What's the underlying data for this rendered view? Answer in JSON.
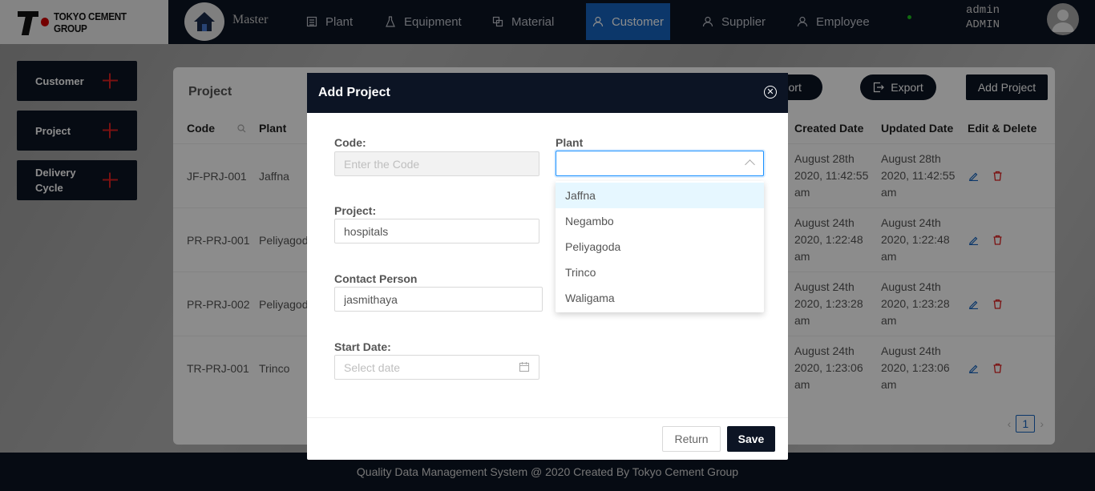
{
  "brand": {
    "name": "TOKYO CEMENT GROUP"
  },
  "nav": {
    "master": "Master",
    "items": [
      {
        "label": "Plant"
      },
      {
        "label": "Equipment"
      },
      {
        "label": "Material"
      },
      {
        "label": "Customer"
      },
      {
        "label": "Supplier"
      },
      {
        "label": "Employee"
      }
    ],
    "active": "Customer",
    "user": {
      "name": "admin",
      "role": "ADMIN"
    }
  },
  "sidebar": [
    {
      "label": "Customer"
    },
    {
      "label": "Project"
    },
    {
      "label": "Delivery Cycle"
    }
  ],
  "panel": {
    "title": "Project",
    "import_label": "Import",
    "export_label": "Export",
    "add_label": "Add Project",
    "columns": {
      "code": "Code",
      "plant": "Plant",
      "created": "Created Date",
      "updated": "Updated Date",
      "actions": "Edit & Delete"
    },
    "rows": [
      {
        "code": "JF-PRJ-001",
        "plant": "Jaffna",
        "created": "August 28th 2020, 11:42:55 am",
        "updated": "August 28th 2020, 11:42:55 am"
      },
      {
        "code": "PR-PRJ-001",
        "plant": "Peliyagoda",
        "created": "August 24th 2020, 1:22:48 am",
        "updated": "August 24th 2020, 1:22:48 am"
      },
      {
        "code": "PR-PRJ-002",
        "plant": "Peliyagoda",
        "created": "August 24th 2020, 1:23:28 am",
        "updated": "August 24th 2020, 1:23:28 am"
      },
      {
        "code": "TR-PRJ-001",
        "plant": "Trinco",
        "created": "August 24th 2020, 1:23:06 am",
        "updated": "August 24th 2020, 1:23:06 am"
      }
    ],
    "page": "1"
  },
  "modal": {
    "title": "Add Project",
    "code_label": "Code:",
    "code_placeholder": "Enter the Code",
    "plant_label": "Plant",
    "plant_value": "",
    "plant_options": [
      "Jaffna",
      "Negambo",
      "Peliyagoda",
      "Trinco",
      "Waligama"
    ],
    "highlighted_option": "Jaffna",
    "project_label": "Project:",
    "project_value": "hospitals",
    "contact_label": "Contact Person",
    "contact_value": "jasmithaya",
    "start_label": "Start Date:",
    "start_placeholder": "Select date",
    "return_label": "Return",
    "save_label": "Save"
  },
  "footer": {
    "text": "Quality Data Management System @ 2020 Created By Tokyo Cement Group"
  },
  "colors": {
    "navy": "#0c1424",
    "accent": "#1665c1",
    "danger": "#e02020",
    "status": "#1ec21e"
  }
}
